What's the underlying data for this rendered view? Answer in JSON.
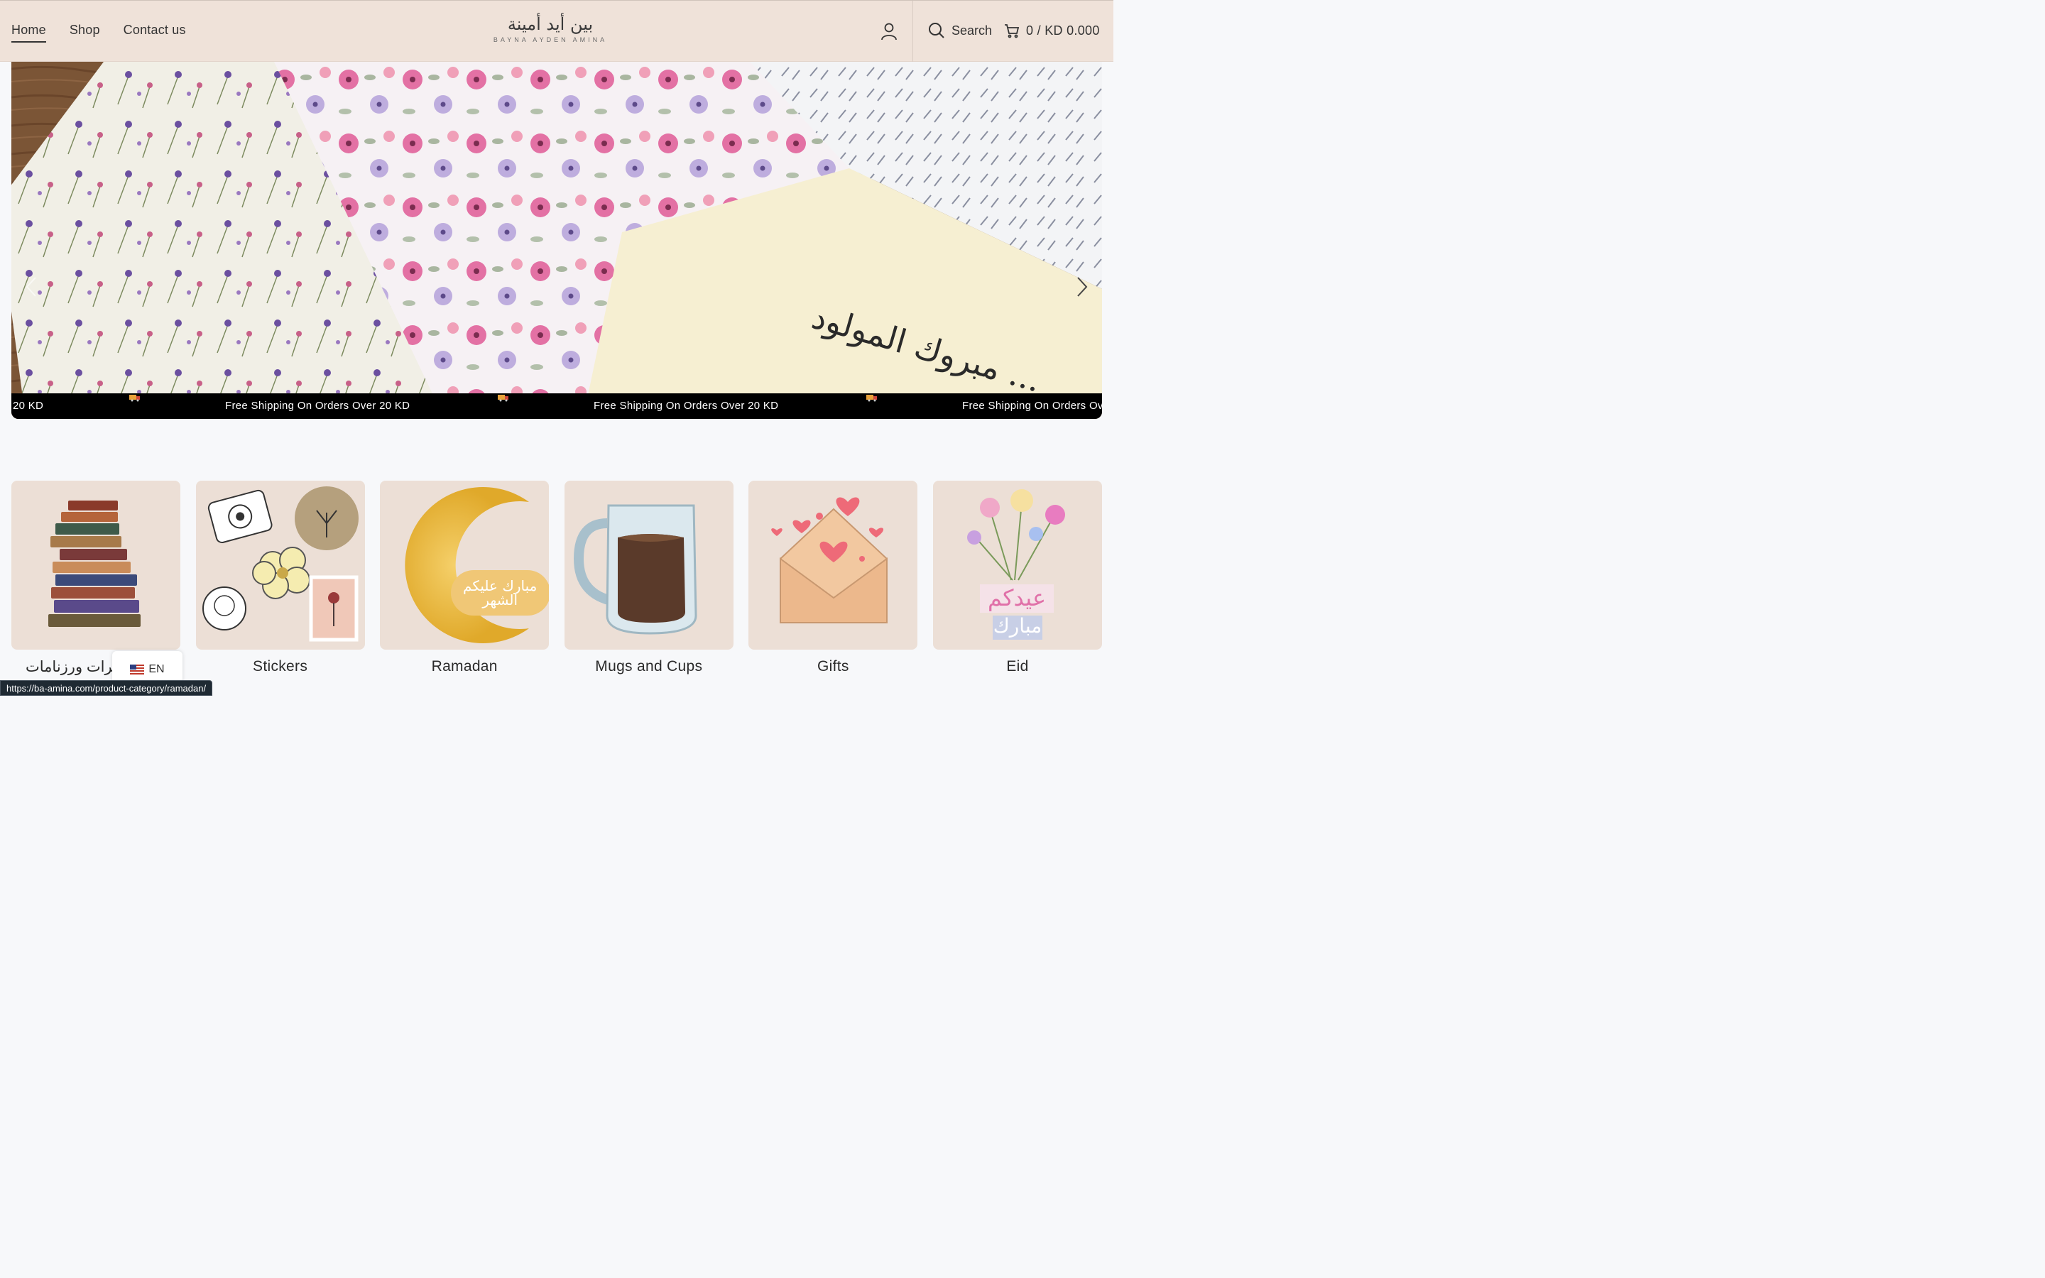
{
  "header": {
    "nav": [
      "Home",
      "Shop",
      "Contact us"
    ],
    "active_nav": "Home",
    "logo_arabic": "بين أيد أمينة",
    "logo_english": "BAYNA AYDEN AMINA",
    "search_label": "Search",
    "cart_label": "0 / KD 0.000"
  },
  "hero": {
    "handwritten_text": "مبروك المولود ...",
    "ticker": "Free Shipping On Orders Over 20 KD",
    "ticker_fragment_start": "20 KD",
    "ticker_fragment_end": "Free Shipping On Orders Ov"
  },
  "categories": [
    {
      "label": "كرات ورزنامات",
      "icon": "books-illustration"
    },
    {
      "label": "Stickers",
      "icon": "stickers-illustration"
    },
    {
      "label": "Ramadan",
      "icon": "crescent-illustration",
      "badge": "مبارك عليكم الشهر"
    },
    {
      "label": "Mugs and Cups",
      "icon": "glass-mug-illustration"
    },
    {
      "label": "Gifts",
      "icon": "envelope-hearts-illustration"
    },
    {
      "label": "Eid",
      "icon": "flowers-illustration",
      "badge_line1": "عيدكم",
      "badge_line2": "مبارك"
    }
  ],
  "language": {
    "code": "EN",
    "flag": "us-flag-icon"
  },
  "status_bar": {
    "url": "https://ba-amina.com/product-category/ramadan/"
  },
  "colors": {
    "header_bg": "#efe2d9",
    "tile_bg": "#ecdfd6",
    "ticker_bg": "#000000",
    "page_bg": "#f7f8fa"
  }
}
